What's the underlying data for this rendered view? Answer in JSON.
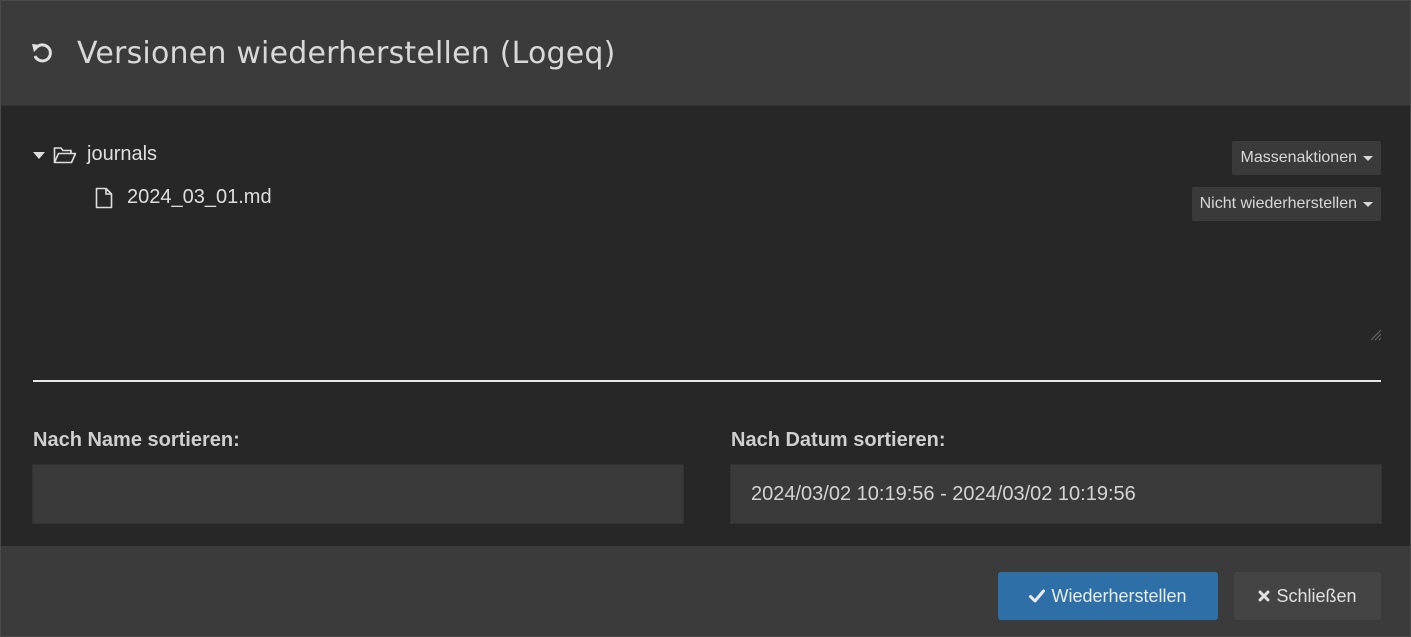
{
  "dialog": {
    "title": "Versionen wiederherstellen (Logeq)",
    "title_icon": "undo-icon"
  },
  "tree": {
    "folder": {
      "label": "journals",
      "icon": "folder-open-icon",
      "expanded": true
    },
    "file": {
      "label": "2024_03_01.md",
      "icon": "file-icon"
    }
  },
  "actions": {
    "bulk_label": "Massenaktionen",
    "restore_mode_label": "Nicht wiederherstellen"
  },
  "filters": {
    "name_label": "Nach Name sortieren:",
    "name_value": "",
    "date_label": "Nach Datum sortieren:",
    "date_value": "2024/03/02 10:19:56 - 2024/03/02 10:19:56"
  },
  "footer": {
    "restore_label": "Wiederherstellen",
    "close_label": "Schließen",
    "primary_color": "#2d6fa6"
  }
}
